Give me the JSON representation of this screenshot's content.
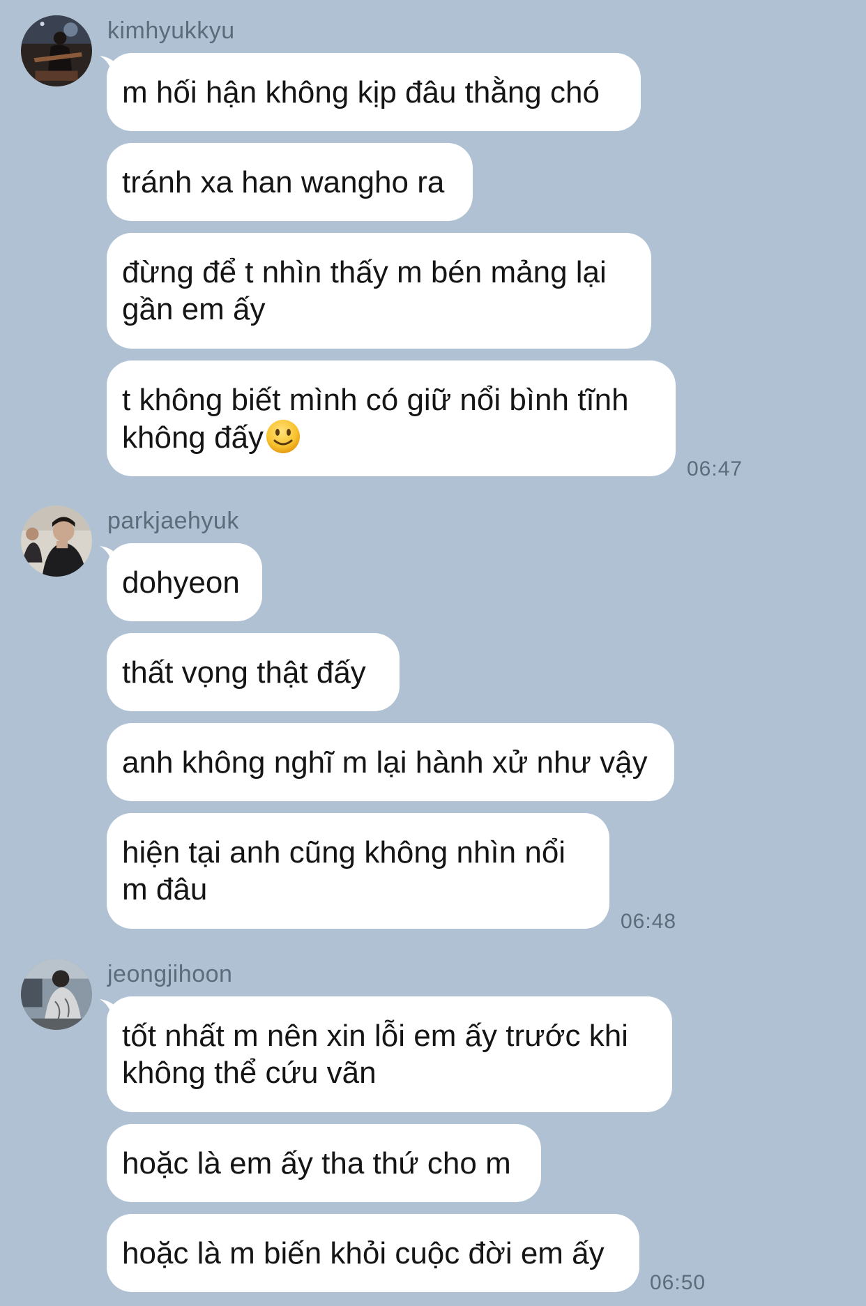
{
  "groups": [
    {
      "sender": "kimhyukkyu",
      "avatar_icon": "person-with-guitar-avatar",
      "messages": [
        "m hối hận không kịp đâu thằng chó",
        "tránh xa han wangho ra",
        "đừng để t nhìn thấy m bén mảng lại\ngần em ấy",
        "t không biết mình có giữ nổi bình tĩnh\nkhông đấy"
      ],
      "emoji": "slightly-smiling-face-icon",
      "time": "06:47"
    },
    {
      "sender": "parkjaehyuk",
      "avatar_icon": "person-photo-avatar",
      "messages": [
        "dohyeon",
        "thất vọng thật đấy",
        "anh không nghĩ m lại hành xử như vậy",
        "hiện tại anh cũng không nhìn nổi\nm đâu"
      ],
      "time": "06:48"
    },
    {
      "sender": "jeongjihoon",
      "avatar_icon": "person-photo-avatar",
      "messages": [
        "tốt nhất m nên xin lỗi em ấy trước khi\nkhông thể cứu vãn",
        "hoặc là em ấy tha thứ cho m",
        "hoặc là m biến khỏi cuộc đời em ấy"
      ],
      "time": "06:50"
    }
  ],
  "colors": {
    "background": "#afc1d2",
    "bubble": "#ffffff",
    "meta_text": "#5b6c7b",
    "message_text": "#151515"
  }
}
